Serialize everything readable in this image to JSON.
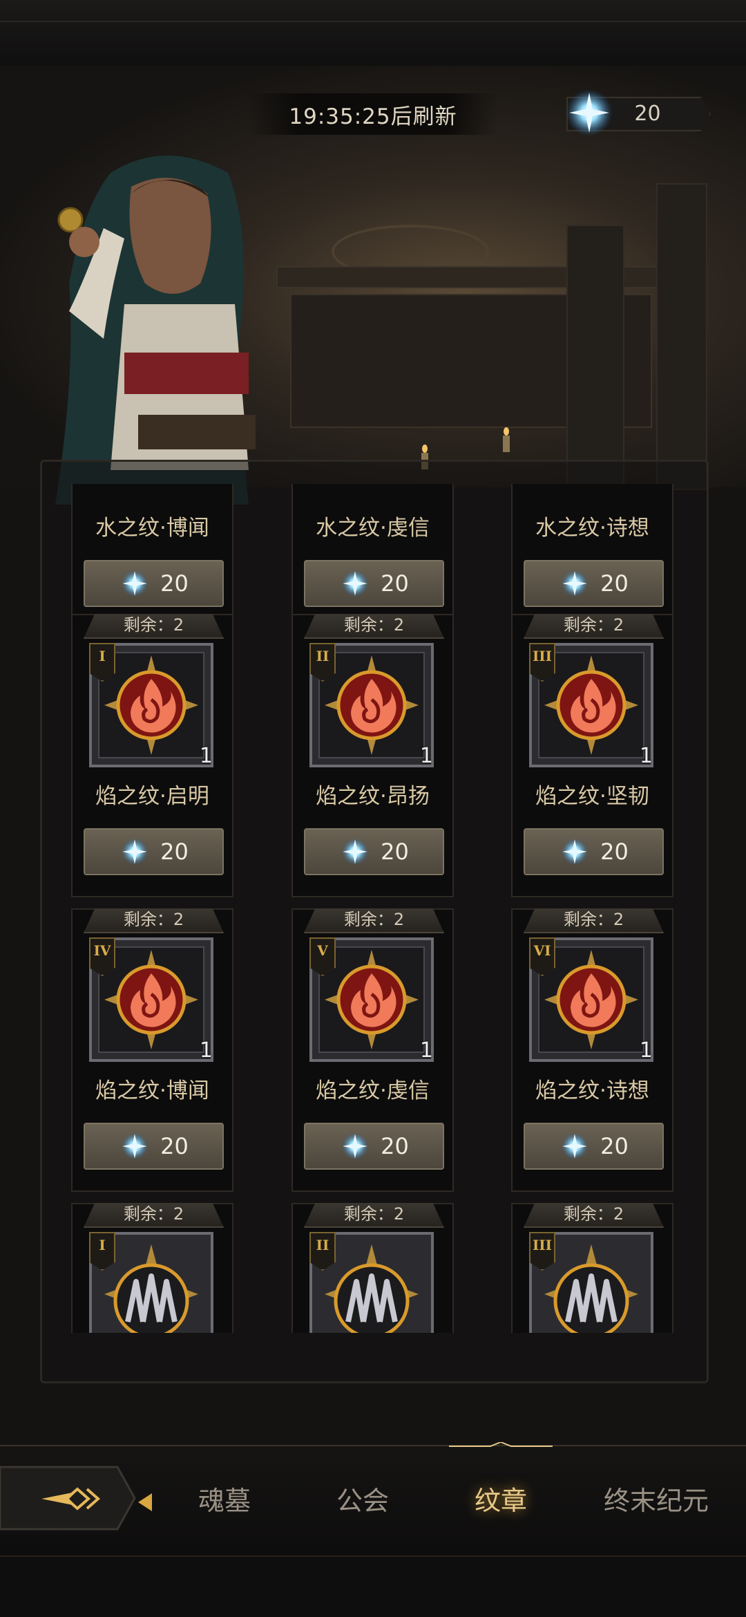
{
  "header": {
    "refresh_text": "19:35:25后刷新",
    "currency_value": "20",
    "currency_icon": "frost-crystal-icon"
  },
  "shop_items": [
    {
      "stock": "",
      "name": "水之纹·博闻",
      "price": "20",
      "tier": "",
      "qty": "",
      "icon": "water-emblem-icon",
      "partial": true
    },
    {
      "stock": "",
      "name": "水之纹·虔信",
      "price": "20",
      "tier": "",
      "qty": "",
      "icon": "water-emblem-icon",
      "partial": true
    },
    {
      "stock": "",
      "name": "水之纹·诗想",
      "price": "20",
      "tier": "",
      "qty": "",
      "icon": "water-emblem-icon",
      "partial": true
    },
    {
      "stock": "剩余：2",
      "name": "焰之纹·启明",
      "price": "20",
      "tier": "I",
      "qty": "1",
      "icon": "flame-emblem-icon"
    },
    {
      "stock": "剩余：2",
      "name": "焰之纹·昂扬",
      "price": "20",
      "tier": "II",
      "qty": "1",
      "icon": "flame-emblem-icon"
    },
    {
      "stock": "剩余：2",
      "name": "焰之纹·坚韧",
      "price": "20",
      "tier": "III",
      "qty": "1",
      "icon": "flame-emblem-icon"
    },
    {
      "stock": "剩余：2",
      "name": "焰之纹·博闻",
      "price": "20",
      "tier": "IV",
      "qty": "1",
      "icon": "flame-emblem-icon"
    },
    {
      "stock": "剩余：2",
      "name": "焰之纹·虔信",
      "price": "20",
      "tier": "V",
      "qty": "1",
      "icon": "flame-emblem-icon"
    },
    {
      "stock": "剩余：2",
      "name": "焰之纹·诗想",
      "price": "20",
      "tier": "VI",
      "qty": "1",
      "icon": "flame-emblem-icon"
    },
    {
      "stock": "剩余：2",
      "name": "",
      "price": "",
      "tier": "I",
      "qty": "",
      "icon": "claw-emblem-icon",
      "partial": true
    },
    {
      "stock": "剩余：2",
      "name": "",
      "price": "",
      "tier": "II",
      "qty": "",
      "icon": "claw-emblem-icon",
      "partial": true
    },
    {
      "stock": "剩余：2",
      "name": "",
      "price": "",
      "tier": "III",
      "qty": "",
      "icon": "claw-emblem-icon",
      "partial": true
    }
  ],
  "nav": {
    "items": [
      "魂墓",
      "公会",
      "纹章",
      "终末纪元"
    ],
    "active": "纹章"
  },
  "colors": {
    "accent_gold": "#e7c988",
    "flame_red": "#c0321f",
    "frost_blue": "#7fd4ff"
  }
}
